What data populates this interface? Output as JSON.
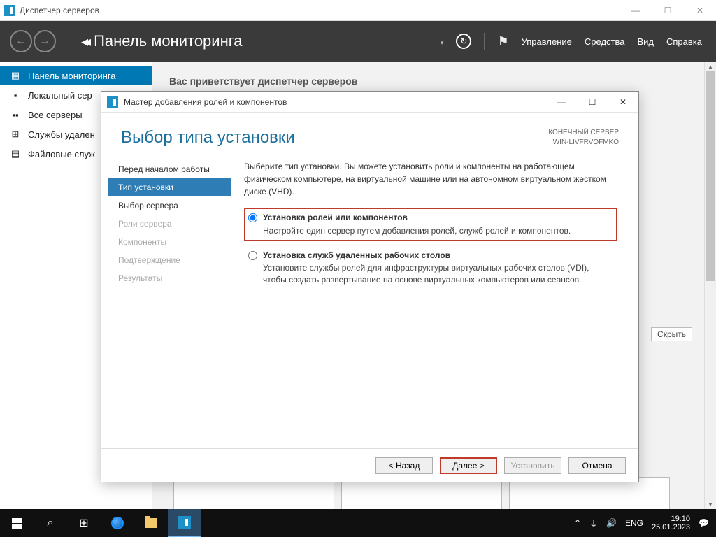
{
  "window": {
    "title": "Диспетчер серверов"
  },
  "header": {
    "title": "Панель мониторинга",
    "menu": {
      "manage": "Управление",
      "tools": "Средства",
      "view": "Вид",
      "help": "Справка"
    }
  },
  "sidebar": {
    "items": [
      {
        "label": "Панель мониторинга",
        "glyph": "▦"
      },
      {
        "label": "Локальный сер",
        "glyph": "▪"
      },
      {
        "label": "Все серверы",
        "glyph": "▪▪"
      },
      {
        "label": "Службы удален",
        "glyph": "⊞"
      },
      {
        "label": "Файловые служ",
        "glyph": "▤"
      }
    ]
  },
  "main": {
    "welcome": "Вас приветствует диспетчер серверов",
    "hide": "Скрыть"
  },
  "wizard": {
    "title": "Мастер добавления ролей и компонентов",
    "heading": "Выбор типа установки",
    "server_label": "КОНЕЧНЫЙ СЕРВЕР",
    "server_name": "WIN-LIVFRVQFMKO",
    "steps": [
      {
        "label": "Перед началом работы",
        "state": "done"
      },
      {
        "label": "Тип установки",
        "state": "current"
      },
      {
        "label": "Выбор сервера",
        "state": "pending"
      },
      {
        "label": "Роли сервера",
        "state": "disabled"
      },
      {
        "label": "Компоненты",
        "state": "disabled"
      },
      {
        "label": "Подтверждение",
        "state": "disabled"
      },
      {
        "label": "Результаты",
        "state": "disabled"
      }
    ],
    "intro": "Выберите тип установки. Вы можете установить роли и компоненты на работающем физическом компьютере, на виртуальной машине или на автономном виртуальном жестком диске (VHD).",
    "options": [
      {
        "title": "Установка ролей или компонентов",
        "desc": "Настройте один сервер путем добавления ролей, служб ролей и компонентов.",
        "selected": true,
        "highlight": true
      },
      {
        "title": "Установка служб удаленных рабочих столов",
        "desc": "Установите службы ролей для инфраструктуры виртуальных рабочих столов (VDI), чтобы создать развертывание на основе виртуальных компьютеров или сеансов.",
        "selected": false,
        "highlight": false
      }
    ],
    "buttons": {
      "back": "< Назад",
      "next": "Далее >",
      "install": "Установить",
      "cancel": "Отмена"
    }
  },
  "taskbar": {
    "lang": "ENG",
    "time": "19:10",
    "date": "25.01.2023"
  }
}
